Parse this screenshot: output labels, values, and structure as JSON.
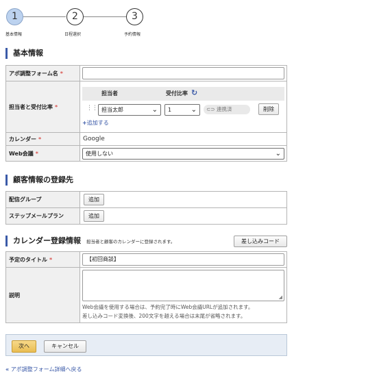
{
  "stepper": {
    "steps": [
      {
        "number": "1",
        "label": "基本情報"
      },
      {
        "number": "2",
        "label": "日程選択"
      },
      {
        "number": "3",
        "label": "予約情報"
      }
    ]
  },
  "basic": {
    "heading": "基本情報",
    "form_name_label": "アポ調整フォーム名",
    "form_name_value": "",
    "staff_label": "担当者と受付比率",
    "staff_col_header": "担当者",
    "ratio_col_header": "受付比率",
    "staff_value": "担当太郎",
    "ratio_value": "1",
    "linked_label": "連携済",
    "delete_button": "削除",
    "add_link": "追加する",
    "calendar_label": "カレンダー",
    "calendar_value": "Google",
    "web_meeting_label": "Web会議",
    "web_meeting_value": "使用しない",
    "required_mark": "*"
  },
  "customer": {
    "heading": "顧客情報の登録先",
    "group_label": "配信グループ",
    "group_button": "追加",
    "step_label": "ステップメールプラン",
    "step_button": "追加"
  },
  "calendar_reg": {
    "heading": "カレンダー登録情報",
    "note": "担当者と顧客のカレンダーに登録されます。",
    "insert_code_button": "差し込みコード",
    "title_label": "予定のタイトル",
    "title_value": "【初回商談】",
    "desc_label": "説明",
    "help_line1": "Web会議を使用する場合は、予約完了時にWeb会議URLが追加されます。",
    "help_line2": "差し込みコード変換後、200文字を越える場合は末尾が省略されます。"
  },
  "footer": {
    "next_button": "次へ",
    "cancel_button": "キャンセル",
    "back_link": "アポ調整フォーム詳細へ戻る"
  },
  "colors": {
    "accent": "#3b5aa8",
    "required": "#d9534f",
    "active_step": "#bcd2ef",
    "next_button": "#e9bd52"
  }
}
